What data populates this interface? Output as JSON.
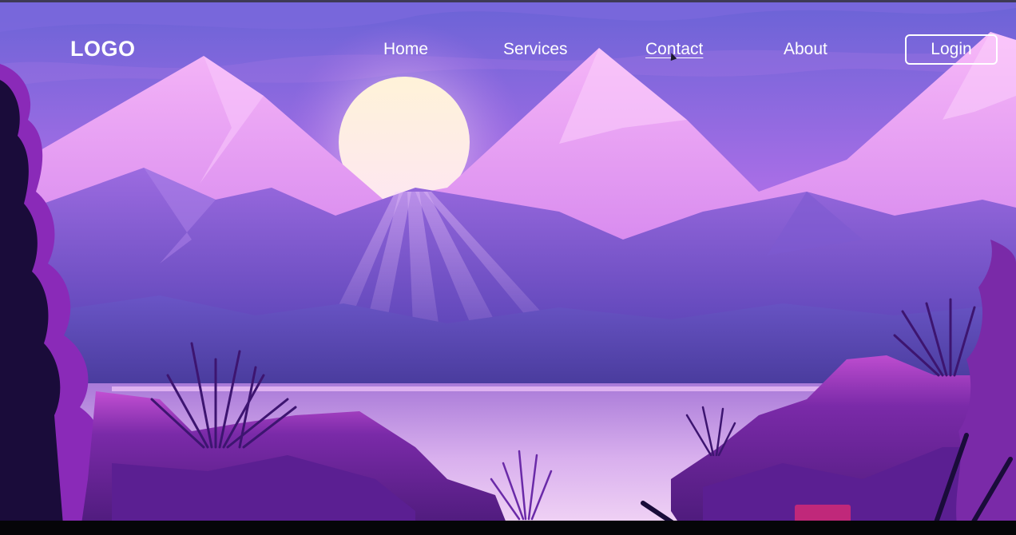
{
  "nav": {
    "logo": "LOGO",
    "links": [
      "Home",
      "Services",
      "Contact",
      "About"
    ],
    "login_label": "Login"
  },
  "theme": {
    "sky_top": "#6e63d8",
    "sky_mid": "#b76ee6",
    "sun": "#fdf2d6",
    "mountain_light": "#e79af0",
    "mountain_mid": "#8a5ad0",
    "mountain_dark": "#4b3aa0",
    "water": "#c8a0e6",
    "foliage": "#5a1a8a",
    "text": "#ffffff"
  },
  "illustration": {
    "subject": "sunset-mountain-lake",
    "elements": [
      "sun",
      "mountains",
      "sun-rays",
      "lake",
      "rocks",
      "grass",
      "foliage"
    ]
  }
}
